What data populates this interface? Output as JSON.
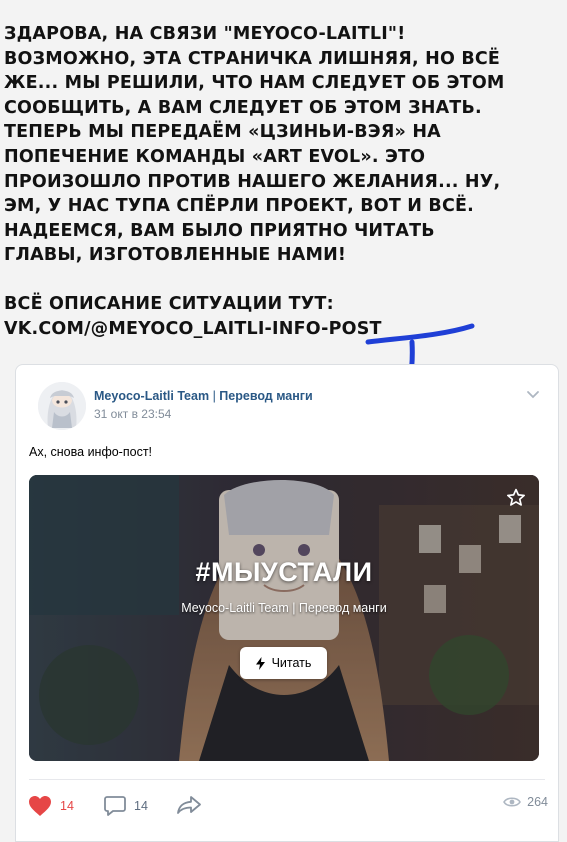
{
  "notice": {
    "lines": [
      "Здарова, на связи \"Meyoco-Laitli\"!",
      "Возможно, эта страничка лишняя, но всё",
      "же... мы решили, что нам следует об этом",
      "сообщить, а вам следует об этом знать.",
      "Теперь мы передаём «Цзиньи-вэя» на",
      "попечение команды «Art Evol». Это",
      "произошло против нашего желания... ну,",
      "эм, у нас тупа спёрли проект, вот и всё.",
      "Надеемся, вам было приятно читать",
      "главы, изготовленные нами!"
    ],
    "link_lines": [
      "Всё описание ситуации тут:",
      "vk.com/@meyoco_laitli-info-post"
    ]
  },
  "post": {
    "author": "Meyoco-Laitli Team",
    "separator": "|",
    "author_suffix": "Перевод манги",
    "date": "31 окт в 23:54",
    "text": "Ах, снова инфо-пост!",
    "snippet": {
      "title": "#МЫУСТАЛИ",
      "subtitle": "Meyoco-Laitli Team | Перевод манги",
      "button_label": "Читать"
    },
    "likes": "14",
    "comments": "14",
    "views": "264"
  },
  "colors": {
    "link": "#2a5885",
    "like": "#e64646",
    "arrow": "#1f3fd6"
  }
}
